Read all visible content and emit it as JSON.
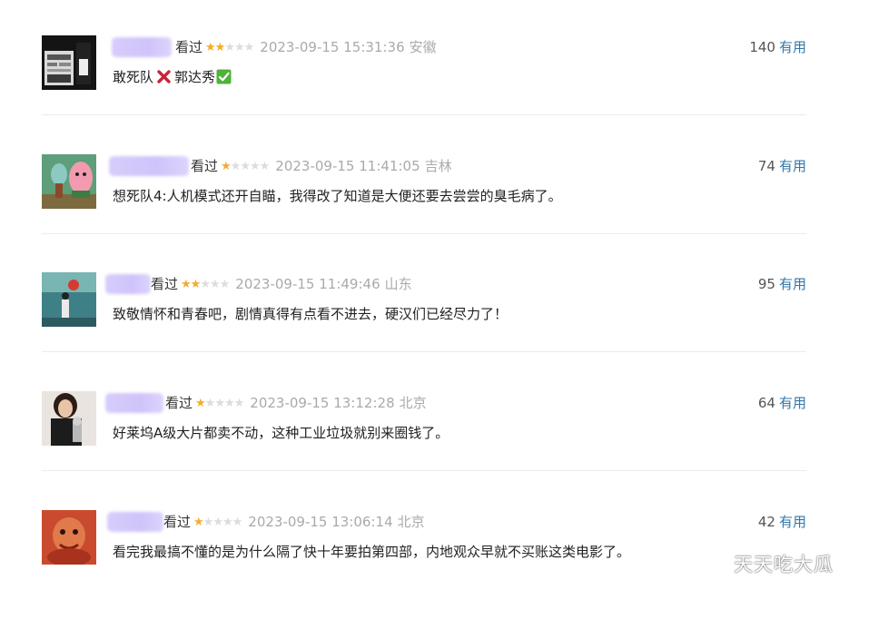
{
  "comments": [
    {
      "status": "看过",
      "rating": 2,
      "time": "2023-09-15 15:31:36",
      "location": "安徽",
      "votes": "140",
      "useful_label": "有用",
      "content_a": "敢死队",
      "content_b": "郭达秀",
      "emoji_1": "cross-mark",
      "emoji_2": "check-mark-button"
    },
    {
      "status": "看过",
      "rating": 1,
      "time": "2023-09-15 11:41:05",
      "location": "吉林",
      "votes": "74",
      "useful_label": "有用",
      "content": "想死队4:人机模式还开自瞄，我得改了知道是大便还要去尝尝的臭毛病了。"
    },
    {
      "status": "看过",
      "rating": 2,
      "time": "2023-09-15 11:49:46",
      "location": "山东",
      "votes": "95",
      "useful_label": "有用",
      "content": "致敬情怀和青春吧，剧情真得有点看不进去，硬汉们已经尽力了！"
    },
    {
      "status": "看过",
      "rating": 1,
      "time": "2023-09-15 13:12:28",
      "location": "北京",
      "votes": "64",
      "useful_label": "有用",
      "content": "好莱坞A级大片都卖不动，这种工业垃圾就别来圈钱了。"
    },
    {
      "status": "看过",
      "rating": 1,
      "time": "2023-09-15 13:06:14",
      "location": "北京",
      "votes": "42",
      "useful_label": "有用",
      "content": "看完我最搞不懂的是为什么隔了快十年要拍第四部，内地观众早就不买账这类电影了。"
    }
  ],
  "watermark": "天天吃大瓜",
  "colors": {
    "star_on": "#f3ab2c",
    "star_off": "#dcdcdc",
    "useful_link": "#3377aa",
    "meta_gray": "#aaaaaa",
    "username_blur": "#d7cdfb"
  }
}
